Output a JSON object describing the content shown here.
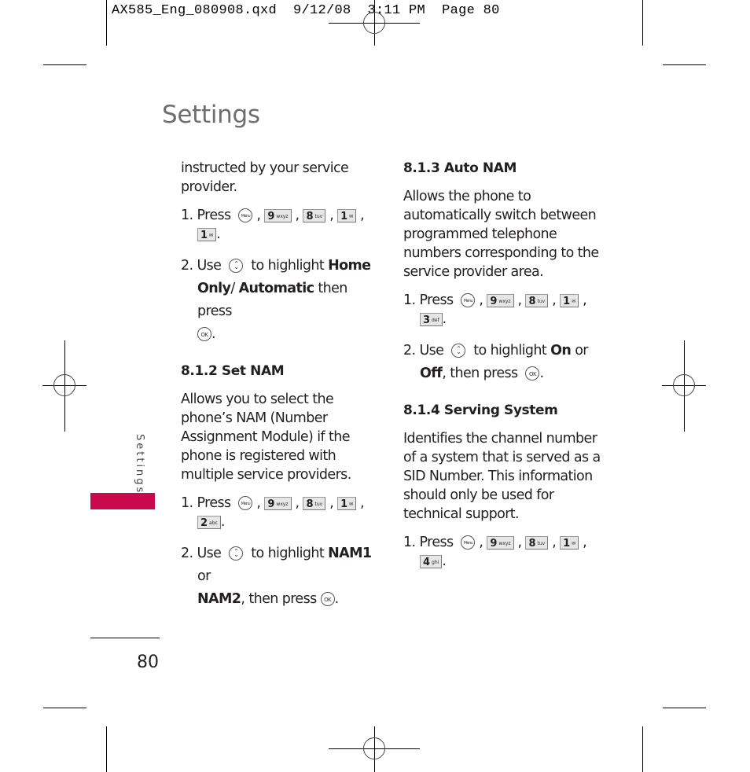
{
  "slug": "AX585_Eng_080908.qxd  9/12/08  3:11 PM  Page 80",
  "page": {
    "title": "Settings",
    "side_tab_label": "Settings",
    "page_number": "80",
    "accent_color": "#c8094c"
  },
  "left_column": {
    "intro": "instructed by your service provider.",
    "steps_a": {
      "press": "1. Press",
      "keys": [
        {
          "type": "menu",
          "label": "Menu"
        },
        {
          "type": "key",
          "num": "9",
          "sub": "wxyz"
        },
        {
          "type": "key",
          "num": "8",
          "sub": "tuv"
        },
        {
          "type": "key",
          "num": "1",
          "sub": "✉"
        },
        {
          "type": "key",
          "num": "1",
          "sub": "✉"
        }
      ],
      "use": "2. Use",
      "highlight": "to highlight",
      "opt1": "Home Only",
      "sep": "/ ",
      "opt2": "Automatic",
      "then": "then press",
      "ok": "OK"
    },
    "section_812": {
      "heading": "8.1.2 Set NAM",
      "body": "Allows you to select the phone’s NAM (Number Assignment Module) if the phone is registered with multiple service providers.",
      "press": "1. Press",
      "keys": [
        {
          "type": "menu",
          "label": "Menu"
        },
        {
          "type": "key",
          "num": "9",
          "sub": "wxyz"
        },
        {
          "type": "key",
          "num": "8",
          "sub": "tuv"
        },
        {
          "type": "key",
          "num": "1",
          "sub": "✉"
        },
        {
          "type": "key",
          "num": "2",
          "sub": "abc"
        }
      ],
      "use": "2. Use",
      "highlight": "to highlight",
      "opt1": "NAM1",
      "or": "or",
      "opt2": "NAM2",
      "then": ", then press",
      "ok": "OK"
    }
  },
  "right_column": {
    "section_813": {
      "heading": "8.1.3 Auto NAM",
      "body": "Allows the phone to automatically switch between programmed telephone numbers corresponding to the service provider area.",
      "press": "1. Press",
      "keys": [
        {
          "type": "menu",
          "label": "Menu"
        },
        {
          "type": "key",
          "num": "9",
          "sub": "wxyz"
        },
        {
          "type": "key",
          "num": "8",
          "sub": "tuv"
        },
        {
          "type": "key",
          "num": "1",
          "sub": "✉"
        },
        {
          "type": "key",
          "num": "3",
          "sub": "def"
        }
      ],
      "use": "2. Use",
      "highlight": "to highlight",
      "opt1": "On",
      "or": "or",
      "opt2": "Off",
      "then": ", then press",
      "ok": "OK"
    },
    "section_814": {
      "heading": "8.1.4 Serving System",
      "body": "Identifies the channel number of a system that is served as a SID Number. This information should only be used for technical support.",
      "press": "1. Press",
      "keys": [
        {
          "type": "menu",
          "label": "Menu"
        },
        {
          "type": "key",
          "num": "9",
          "sub": "wxyz"
        },
        {
          "type": "key",
          "num": "8",
          "sub": "tuv"
        },
        {
          "type": "key",
          "num": "1",
          "sub": "✉"
        },
        {
          "type": "key",
          "num": "4",
          "sub": "ghi"
        }
      ]
    }
  }
}
